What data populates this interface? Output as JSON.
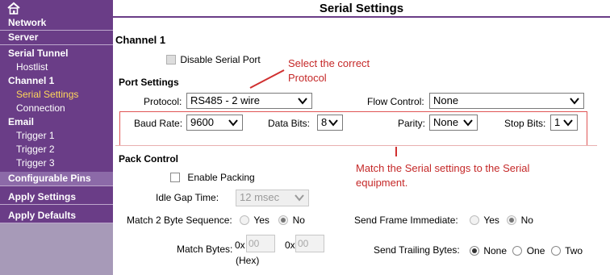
{
  "sidebar": {
    "home_icon": "home-icon",
    "items": [
      {
        "label": "Network"
      },
      {
        "label": "Server"
      },
      {
        "label": "Serial Tunnel"
      },
      {
        "label": "Hostlist"
      },
      {
        "label": "Channel 1"
      },
      {
        "label": "Serial Settings"
      },
      {
        "label": "Connection"
      },
      {
        "label": "Email"
      },
      {
        "label": "Trigger 1"
      },
      {
        "label": "Trigger 2"
      },
      {
        "label": "Trigger 3"
      },
      {
        "label": "Configurable Pins"
      },
      {
        "label": "Apply Settings"
      },
      {
        "label": "Apply Defaults"
      }
    ]
  },
  "page": {
    "title": "Serial Settings",
    "channel_heading": "Channel 1",
    "disable_serial_port": "Disable Serial Port",
    "port_settings_heading": "Port Settings",
    "pack_control_heading": "Pack Control"
  },
  "port": {
    "protocol_label": "Protocol:",
    "protocol_value": "RS485 - 2 wire",
    "flow_control_label": "Flow Control:",
    "flow_control_value": "None",
    "baud_label": "Baud Rate:",
    "baud_value": "9600",
    "data_bits_label": "Data Bits:",
    "data_bits_value": "8",
    "parity_label": "Parity:",
    "parity_value": "None",
    "stop_bits_label": "Stop Bits:",
    "stop_bits_value": "1"
  },
  "pack": {
    "enable_packing": "Enable Packing",
    "idle_gap_label": "Idle Gap Time:",
    "idle_gap_value": "12 msec",
    "match2_label": "Match 2 Byte Sequence:",
    "match2_yes": "Yes",
    "match2_no": "No",
    "send_frame_label": "Send Frame Immediate:",
    "send_frame_yes": "Yes",
    "send_frame_no": "No",
    "match_bytes_label": "Match Bytes:",
    "hex_prefix_1": "0x",
    "hex_value_1": "00",
    "hex_prefix_2": "0x",
    "hex_value_2": "00",
    "hex_unit": "(Hex)",
    "trailing_label": "Send Trailing Bytes:",
    "trailing_none": "None",
    "trailing_one": "One",
    "trailing_two": "Two"
  },
  "annotations": {
    "protocol_note_line1": "Select the correct",
    "protocol_note_line2": "Protocol",
    "serial_note_line1": "Match the Serial settings to the Serial",
    "serial_note_line2": "equipment.",
    "color": "#c52828"
  },
  "colors": {
    "sidebar_bg": "#6a3d87",
    "sidebar_active": "#ffd75a",
    "title_rule": "#6a3d87"
  }
}
